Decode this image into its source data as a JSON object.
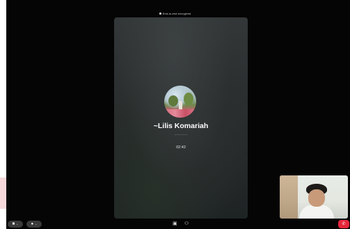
{
  "banner": {
    "text": "End-to-end encrypted",
    "icon": "lock-icon"
  },
  "call": {
    "caller_name": "~Lilis Komariah",
    "status": "..........",
    "duration": "02:42"
  },
  "controls": {
    "video": {
      "icon": "video-camera-icon",
      "glyph": "■",
      "chevron": "⌄"
    },
    "mic": {
      "icon": "microphone-icon",
      "glyph": "●",
      "chevron": "⌄"
    },
    "screen_share": {
      "icon": "screen-share-icon",
      "glyph": "▣"
    },
    "participants": {
      "icon": "add-participant-icon",
      "glyph": "⚇"
    },
    "end_call": {
      "icon": "end-call-icon",
      "glyph": "✆"
    }
  },
  "colors": {
    "end_call": "#e5263b",
    "background": "#050505"
  }
}
